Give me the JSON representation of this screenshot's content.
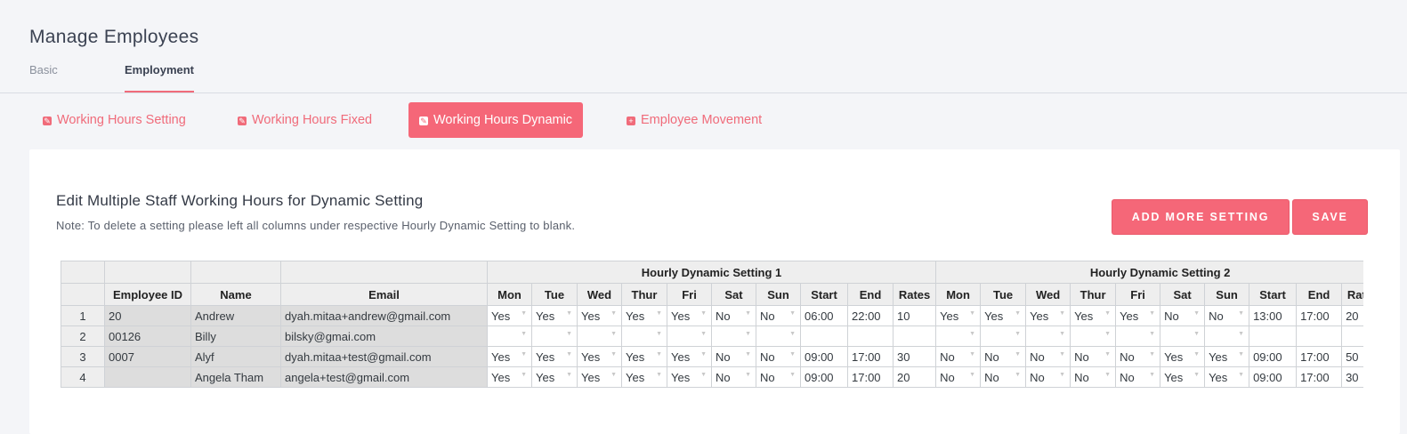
{
  "page_title": "Manage Employees",
  "tabs": [
    {
      "label": "Basic"
    },
    {
      "label": "Employment"
    }
  ],
  "subtabs": [
    {
      "label": "Working Hours Setting",
      "icon": "edit-icon"
    },
    {
      "label": "Working Hours Fixed",
      "icon": "edit-icon"
    },
    {
      "label": "Working Hours Dynamic",
      "icon": "edit-icon"
    },
    {
      "label": "Employee Movement",
      "icon": "plus-icon"
    }
  ],
  "card": {
    "title": "Edit Multiple Staff Working Hours for Dynamic Setting",
    "note": "Note: To delete a setting please left all columns under respective Hourly Dynamic Setting to blank.",
    "add_button": "ADD MORE SETTING",
    "save_button": "SAVE"
  },
  "grid": {
    "group_headers": [
      "Hourly Dynamic Setting 1",
      "Hourly Dynamic Setting 2"
    ],
    "fixed_headers": [
      "Employee ID",
      "Name",
      "Email"
    ],
    "setting_headers": [
      "Mon",
      "Tue",
      "Wed",
      "Thur",
      "Fri",
      "Sat",
      "Sun",
      "Start",
      "End",
      "Rates"
    ],
    "rows": [
      {
        "num": "1",
        "id": "20",
        "name": "Andrew",
        "email": "dyah.mitaa+andrew@gmail.com",
        "s1": [
          "Yes",
          "Yes",
          "Yes",
          "Yes",
          "Yes",
          "No",
          "No",
          "06:00",
          "22:00",
          "10"
        ],
        "s2": [
          "Yes",
          "Yes",
          "Yes",
          "Yes",
          "Yes",
          "No",
          "No",
          "13:00",
          "17:00",
          "20"
        ]
      },
      {
        "num": "2",
        "id": "00126",
        "name": "Billy",
        "email": "bilsky@gmai.com",
        "s1": [
          "",
          "",
          "",
          "",
          "",
          "",
          "",
          "",
          "",
          ""
        ],
        "s2": [
          "",
          "",
          "",
          "",
          "",
          "",
          "",
          "",
          "",
          ""
        ]
      },
      {
        "num": "3",
        "id": "0007",
        "name": "Alyf",
        "email": "dyah.mitaa+test@gmail.com",
        "s1": [
          "Yes",
          "Yes",
          "Yes",
          "Yes",
          "Yes",
          "No",
          "No",
          "09:00",
          "17:00",
          "30"
        ],
        "s2": [
          "No",
          "No",
          "No",
          "No",
          "No",
          "Yes",
          "Yes",
          "09:00",
          "17:00",
          "50"
        ]
      },
      {
        "num": "4",
        "id": "",
        "name": "Angela Tham",
        "email": "angela+test@gmail.com",
        "s1": [
          "Yes",
          "Yes",
          "Yes",
          "Yes",
          "Yes",
          "No",
          "No",
          "09:00",
          "17:00",
          "20"
        ],
        "s2": [
          "No",
          "No",
          "No",
          "No",
          "No",
          "Yes",
          "Yes",
          "09:00",
          "17:00",
          "30"
        ]
      }
    ]
  },
  "colors": {
    "accent": "#f56778",
    "link": "#f06b7a"
  }
}
